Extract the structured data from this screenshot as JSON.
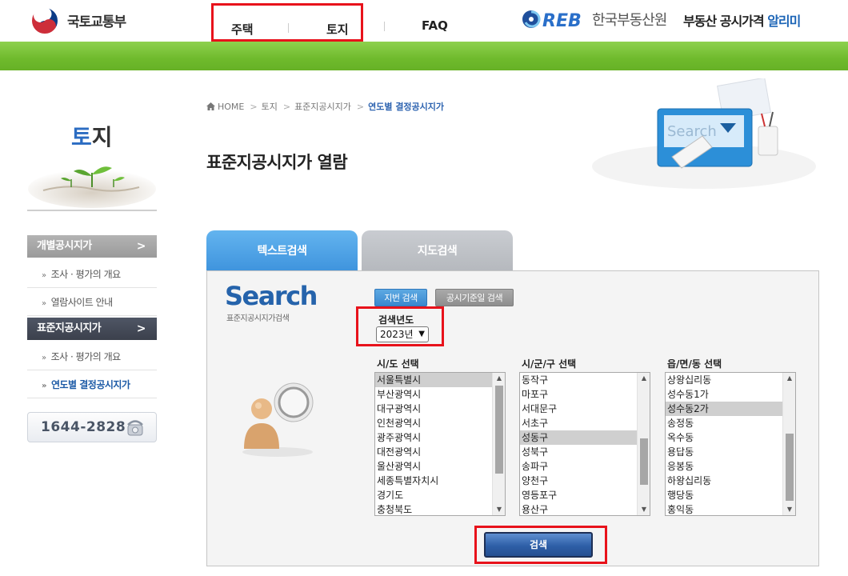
{
  "header": {
    "ministry_name": "국토교통부",
    "nav": [
      {
        "label": "주택"
      },
      {
        "label": "토지"
      },
      {
        "label": "FAQ"
      }
    ],
    "reb_logo_text": "REB",
    "reb_name": "한국부동산원",
    "site_title_prefix": "부동산 공시가격",
    "site_title_highlight": "알리미"
  },
  "sidebar": {
    "title_first": "토",
    "title_rest": "지",
    "menus": [
      {
        "label": "개별공시지가",
        "chevron": ">",
        "items": [
          {
            "label": "조사 · 평가의 개요"
          },
          {
            "label": "열람사이트 안내"
          }
        ]
      },
      {
        "label": "표준지공시지가",
        "chevron": ">",
        "items": [
          {
            "label": "조사 · 평가의 개요"
          },
          {
            "label": "연도별 결정공시지가"
          }
        ]
      }
    ],
    "phone": "1644-2828"
  },
  "breadcrumb": {
    "items": [
      "HOME",
      "토지",
      "표준지공시지가"
    ],
    "separator": ">",
    "current": "연도별 결정공시지가"
  },
  "page_title": "표준지공시지가 열람",
  "art_text": "Search",
  "tabs": [
    {
      "label": "텍스트검색"
    },
    {
      "label": "지도검색"
    }
  ],
  "panel": {
    "logo": "Search",
    "logo_sub": "표준지공시지가검색",
    "buttons": {
      "jibun": "지번 검색",
      "date": "공시기준일 검색"
    },
    "year_label": "검색년도",
    "year_value": "2023년",
    "sido": {
      "label": "시/도 선택",
      "options": [
        "서울특별시",
        "부산광역시",
        "대구광역시",
        "인천광역시",
        "광주광역시",
        "대전광역시",
        "울산광역시",
        "세종특별자치시",
        "경기도",
        "충청북도"
      ],
      "selected": "서울특별시"
    },
    "sigungu": {
      "label": "시/군/구 선택",
      "options": [
        "동작구",
        "마포구",
        "서대문구",
        "서초구",
        "성동구",
        "성북구",
        "송파구",
        "양천구",
        "영등포구",
        "용산구"
      ],
      "selected": "성동구"
    },
    "dong": {
      "label": "읍/면/동 선택",
      "options": [
        "상왕십리동",
        "성수동1가",
        "성수동2가",
        "송정동",
        "옥수동",
        "용답동",
        "응봉동",
        "하왕십리동",
        "행당동",
        "홍익동"
      ],
      "selected": "성수동2가"
    },
    "search_button": "검색"
  },
  "colors": {
    "accent_blue": "#2b6cc2",
    "green_bar": "#6fba2c",
    "highlight_red": "#e8121b"
  }
}
